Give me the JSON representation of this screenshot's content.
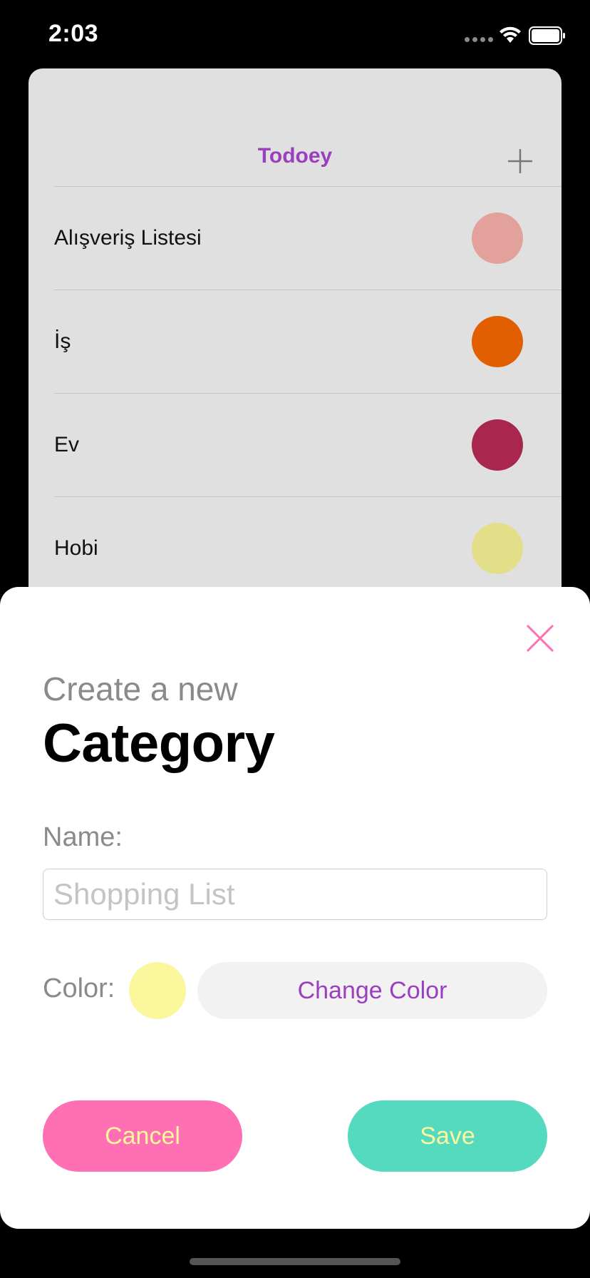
{
  "status_bar": {
    "time": "2:03"
  },
  "list": {
    "title": "Todoey",
    "categories": [
      {
        "label": "Alışveriş Listesi",
        "color": "#e3a19b"
      },
      {
        "label": "İş",
        "color": "#e15f00"
      },
      {
        "label": "Ev",
        "color": "#a9274f"
      },
      {
        "label": "Hobi",
        "color": "#e3de88"
      }
    ]
  },
  "sheet": {
    "subtitle": "Create a new",
    "title": "Category",
    "name_label": "Name:",
    "name_placeholder": "Shopping List",
    "name_value": "",
    "color_label": "Color:",
    "selected_color": "#fbf79c",
    "change_color_label": "Change Color",
    "cancel_label": "Cancel",
    "save_label": "Save"
  },
  "colors": {
    "accent": "#9b3fbf",
    "close": "#ff6fb4",
    "cancel_bg": "#ff6fb4",
    "save_bg": "#55dac0",
    "button_text": "#fbf79c"
  }
}
